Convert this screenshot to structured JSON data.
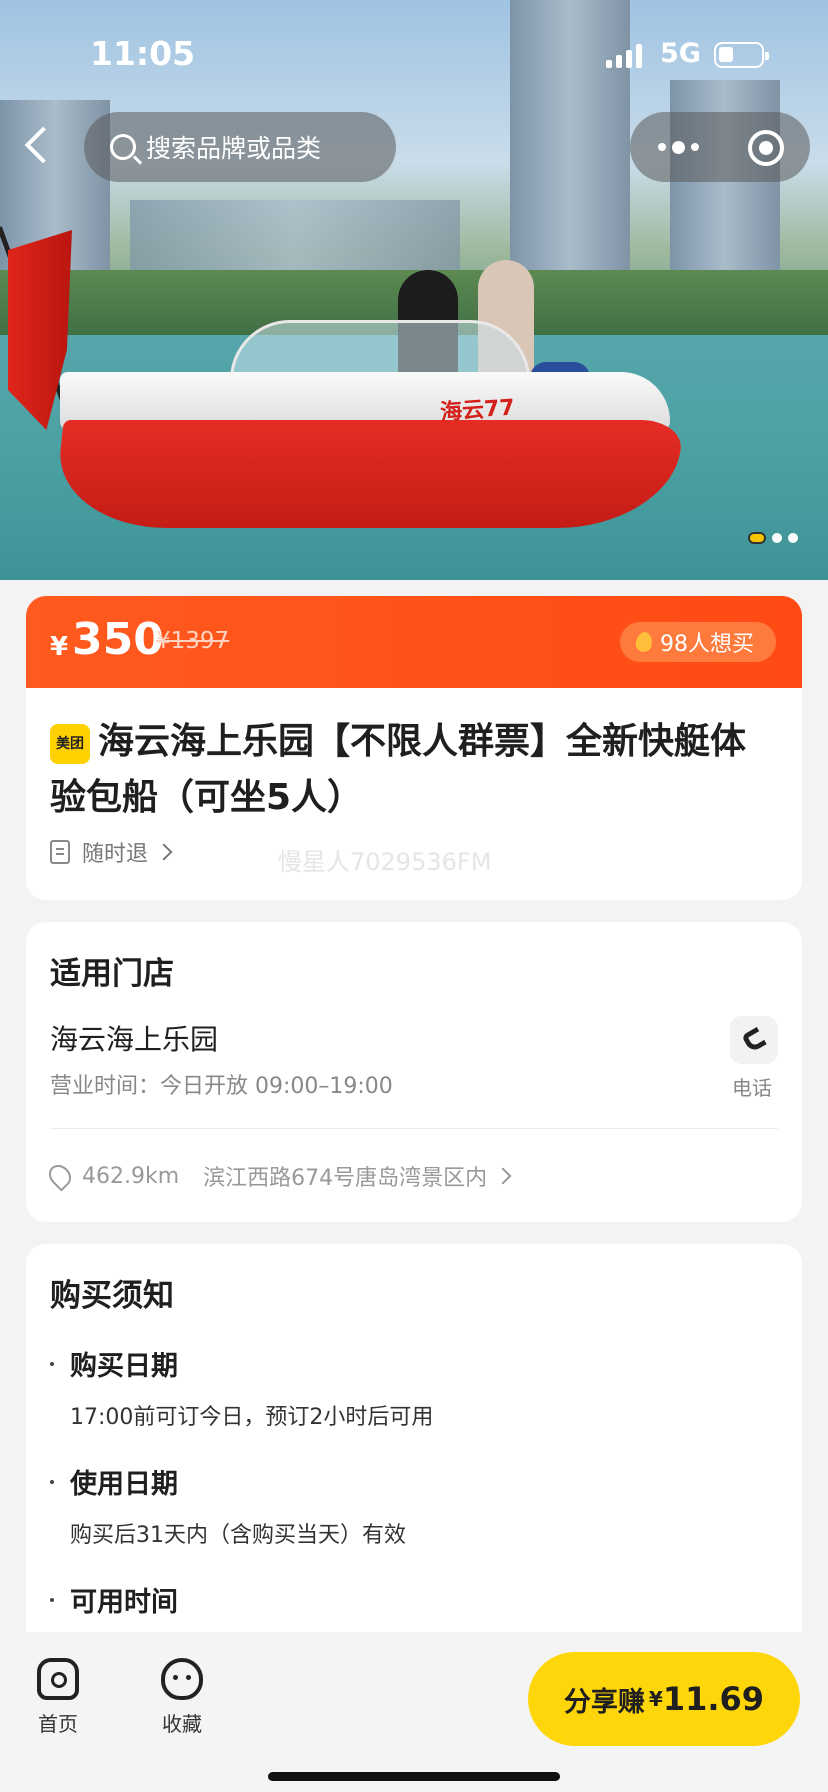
{
  "status_bar": {
    "time": "11:05",
    "network": "5G"
  },
  "nav": {
    "search_placeholder": "搜索品牌或品类"
  },
  "hero": {
    "boat_name": "海云77",
    "pager_count": 3,
    "pager_active": 0
  },
  "price": {
    "currency": "¥",
    "current": "350",
    "original": "¥1397",
    "want_badge": "98人想买"
  },
  "product": {
    "brand_badge": "美团",
    "title": "海云海上乐园【不限人群票】全新快艇体验包船（可坐5人）",
    "refund": "随时退",
    "watermark": "慢星人7029536FM"
  },
  "store": {
    "section_title": "适用门店",
    "name": "海云海上乐园",
    "hours": "营业时间：今日开放 09:00–19:00",
    "phone_label": "电话",
    "distance": "462.9km",
    "address": "滨江西路674号唐岛湾景区内"
  },
  "notice": {
    "section_title": "购买须知",
    "items": [
      {
        "head": "购买日期",
        "body": "17:00前可订今日，预订2小时后可用"
      },
      {
        "head": "使用日期",
        "body": "购买后31天内（含购买当天）有效"
      },
      {
        "head": "可用时间",
        "body": ""
      }
    ]
  },
  "bottom_bar": {
    "home_label": "首页",
    "fav_label": "收藏",
    "share_label": "分享赚",
    "share_currency": "¥",
    "share_amount": "11.69"
  },
  "colors": {
    "accent_orange": "#ff5a1f",
    "accent_yellow": "#ffd60a"
  }
}
